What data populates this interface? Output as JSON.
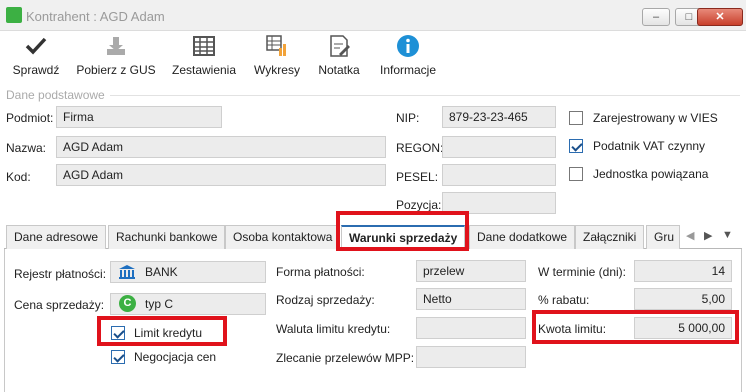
{
  "window": {
    "title": "Kontrahent : AGD Adam",
    "min": "–",
    "max": "□",
    "close": "✕"
  },
  "toolbar": [
    {
      "label": "Sprawdź",
      "icon": "check-icon"
    },
    {
      "label": "Pobierz z GUS",
      "icon": "download-icon"
    },
    {
      "label": "Zestawienia",
      "icon": "table-icon"
    },
    {
      "label": "Wykresy",
      "icon": "chart-icon"
    },
    {
      "label": "Notatka",
      "icon": "note-icon"
    },
    {
      "label": "Informacje",
      "icon": "info-icon"
    }
  ],
  "section": {
    "title": "Dane podstawowe"
  },
  "basic": {
    "podmiot_label": "Podmiot:",
    "podmiot_value": "Firma",
    "nazwa_label": "Nazwa:",
    "nazwa_value": "AGD Adam",
    "kod_label": "Kod:",
    "kod_value": "AGD Adam",
    "nip_label": "NIP:",
    "nip_value": "879-23-23-465",
    "regon_label": "REGON:",
    "regon_value": "",
    "pesel_label": "PESEL:",
    "pesel_value": "",
    "pozycja_label": "Pozycja:",
    "pozycja_value": ""
  },
  "flags": {
    "vies": {
      "label": "Zarejestrowany w VIES",
      "checked": false
    },
    "vat": {
      "label": "Podatnik VAT czynny",
      "checked": true
    },
    "powiazana": {
      "label": "Jednostka powiązana",
      "checked": false
    }
  },
  "tabs": [
    "Dane adresowe",
    "Rachunki bankowe",
    "Osoba kontaktowa",
    "Warunki sprzedaży",
    "Dane dodatkowe",
    "Załączniki",
    "Gru"
  ],
  "active_tab": "Warunki sprzedaży",
  "sales": {
    "rejestr_label": "Rejestr płatności:",
    "rejestr_value": "BANK",
    "cena_label": "Cena sprzedaży:",
    "cena_value": "typ C",
    "cena_badge": "C",
    "limit_label": "Limit kredytu",
    "limit_checked": true,
    "negocjacja_label": "Negocjacja cen",
    "negocjacja_checked": true,
    "forma_label": "Forma płatności:",
    "forma_value": "przelew",
    "rodzaj_label": "Rodzaj sprzedaży:",
    "rodzaj_value": "Netto",
    "waluta_label": "Waluta limitu kredytu:",
    "waluta_value": "",
    "mpp_label": "Zlecanie przelewów MPP:",
    "mpp_value": "",
    "termin_label": "W terminie (dni):",
    "termin_value": "14",
    "rabat_label": "% rabatu:",
    "rabat_value": "5,00",
    "kwota_label": "Kwota limitu:",
    "kwota_value": "5 000,00"
  },
  "colors": {
    "highlight": "#e0121b",
    "accent": "#2b6cb0"
  }
}
